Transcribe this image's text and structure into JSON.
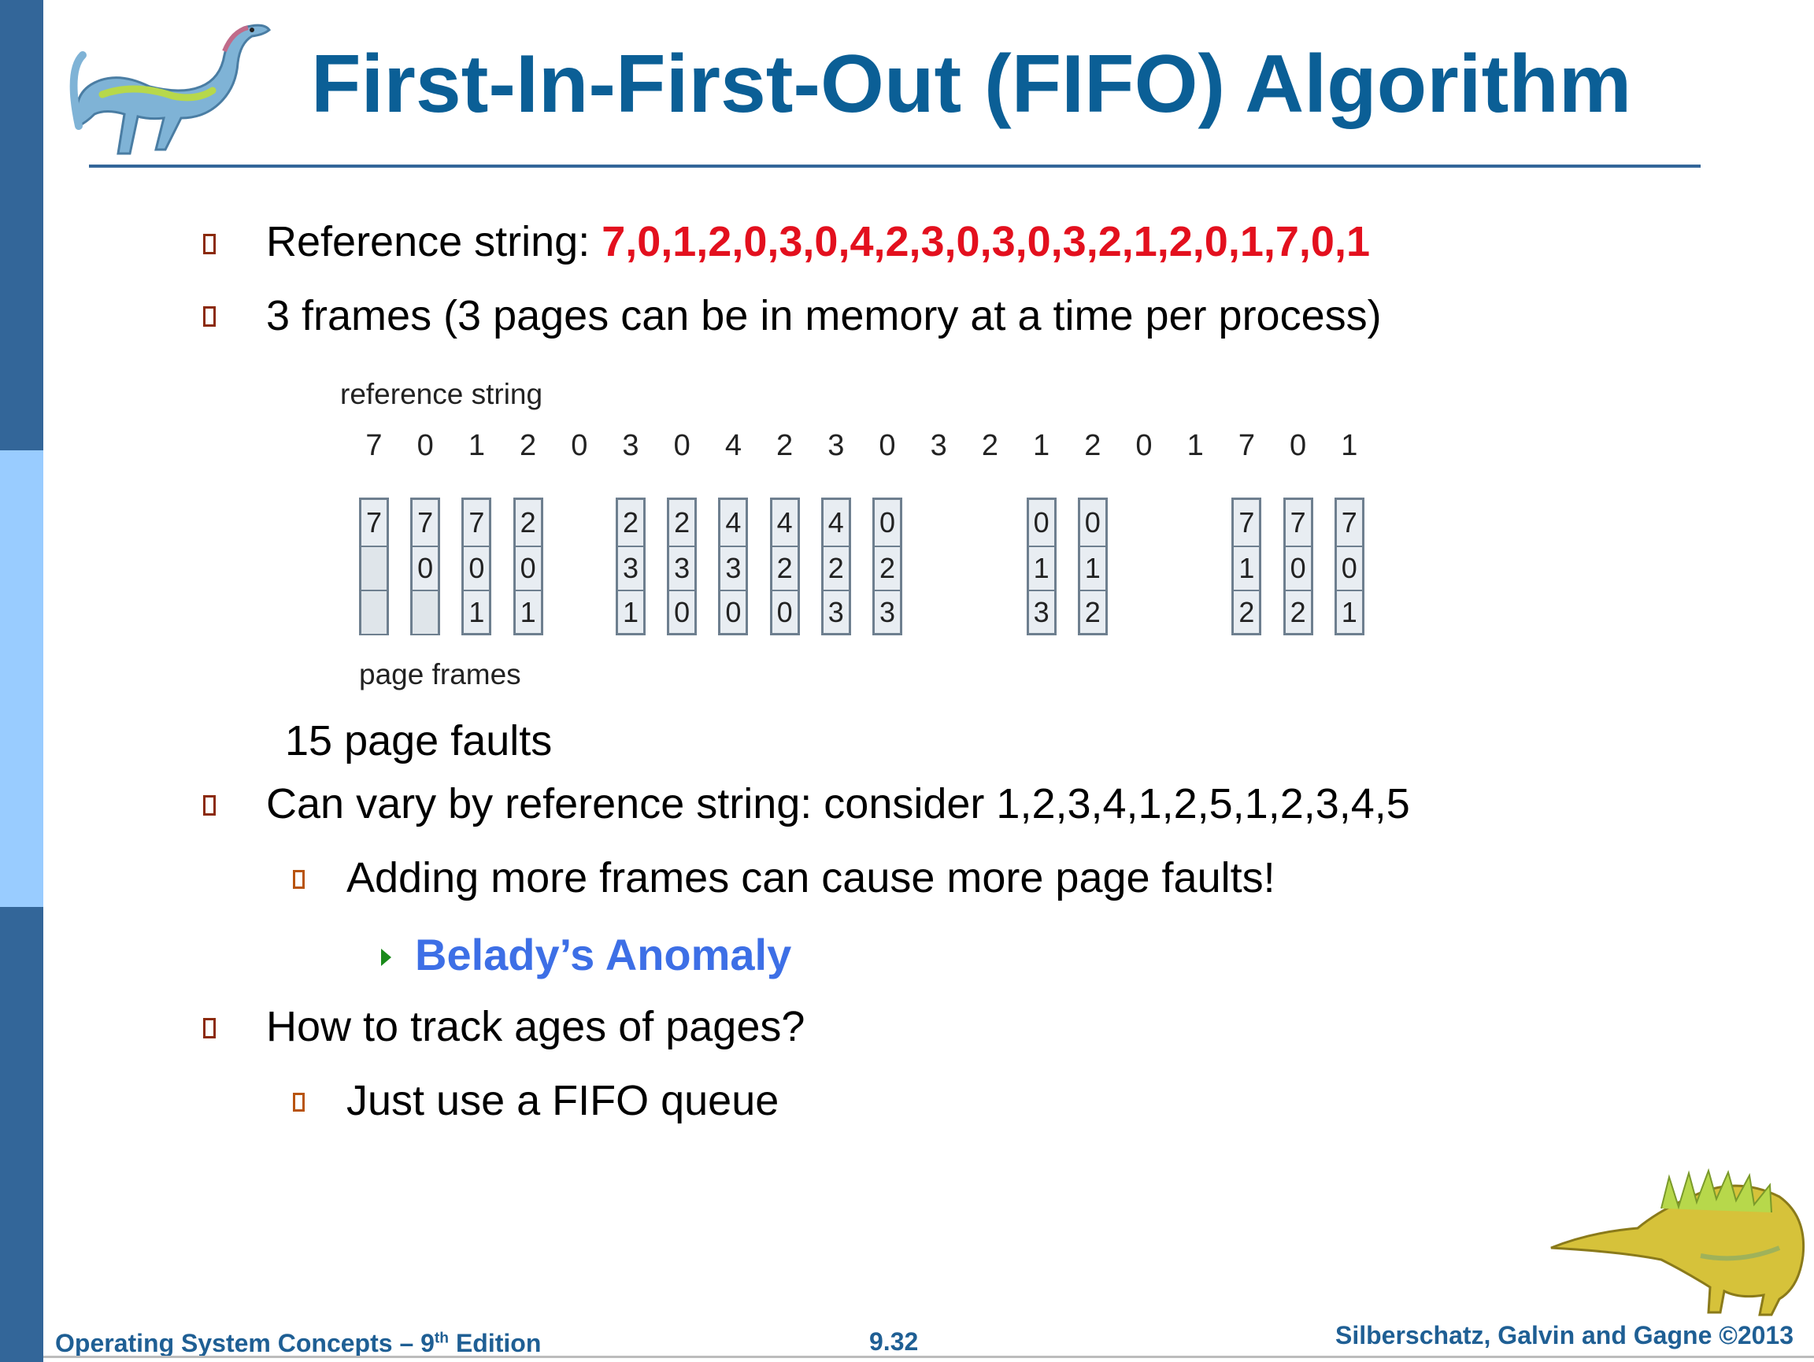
{
  "title": "First-In-First-Out (FIFO) Algorithm",
  "bullets": {
    "ref_label": "Reference string: ",
    "ref_value": "7,0,1,2,0,3,0,4,2,3,0,3,0,3,2,1,2,0,1,7,0,1",
    "frames": "3 frames (3 pages can be in memory at a time per process)",
    "faults": "15 page faults",
    "vary": "Can vary by reference string: consider 1,2,3,4,1,2,5,1,2,3,4,5",
    "adding": "Adding more frames can cause more page faults!",
    "belady": "Belady’s Anomaly",
    "track": "How to track ages of pages?",
    "fifo": "Just use a FIFO queue"
  },
  "diagram": {
    "reference_label": "reference string",
    "page_frames_label": "page frames",
    "reference": [
      "7",
      "0",
      "1",
      "2",
      "0",
      "3",
      "0",
      "4",
      "2",
      "3",
      "0",
      "3",
      "2",
      "1",
      "2",
      "0",
      "1",
      "7",
      "0",
      "1"
    ],
    "frames": [
      {
        "ref_index": 0,
        "cells": [
          "7",
          "",
          ""
        ]
      },
      {
        "ref_index": 1,
        "cells": [
          "7",
          "0",
          ""
        ]
      },
      {
        "ref_index": 2,
        "cells": [
          "7",
          "0",
          "1"
        ]
      },
      {
        "ref_index": 3,
        "cells": [
          "2",
          "0",
          "1"
        ]
      },
      {
        "ref_index": 5,
        "cells": [
          "2",
          "3",
          "1"
        ]
      },
      {
        "ref_index": 6,
        "cells": [
          "2",
          "3",
          "0"
        ]
      },
      {
        "ref_index": 7,
        "cells": [
          "4",
          "3",
          "0"
        ]
      },
      {
        "ref_index": 8,
        "cells": [
          "4",
          "2",
          "0"
        ]
      },
      {
        "ref_index": 9,
        "cells": [
          "4",
          "2",
          "3"
        ]
      },
      {
        "ref_index": 10,
        "cells": [
          "0",
          "2",
          "3"
        ]
      },
      {
        "ref_index": 13,
        "cells": [
          "0",
          "1",
          "3"
        ]
      },
      {
        "ref_index": 14,
        "cells": [
          "0",
          "1",
          "2"
        ]
      },
      {
        "ref_index": 17,
        "cells": [
          "7",
          "1",
          "2"
        ]
      },
      {
        "ref_index": 18,
        "cells": [
          "7",
          "0",
          "2"
        ]
      },
      {
        "ref_index": 19,
        "cells": [
          "7",
          "0",
          "1"
        ]
      }
    ]
  },
  "footer": {
    "left_pre": "Operating System Concepts – 9",
    "left_sup": "th",
    "left_post": " Edition",
    "center": "9.32",
    "right": "Silberschatz, Galvin and Gagne ©2013"
  }
}
